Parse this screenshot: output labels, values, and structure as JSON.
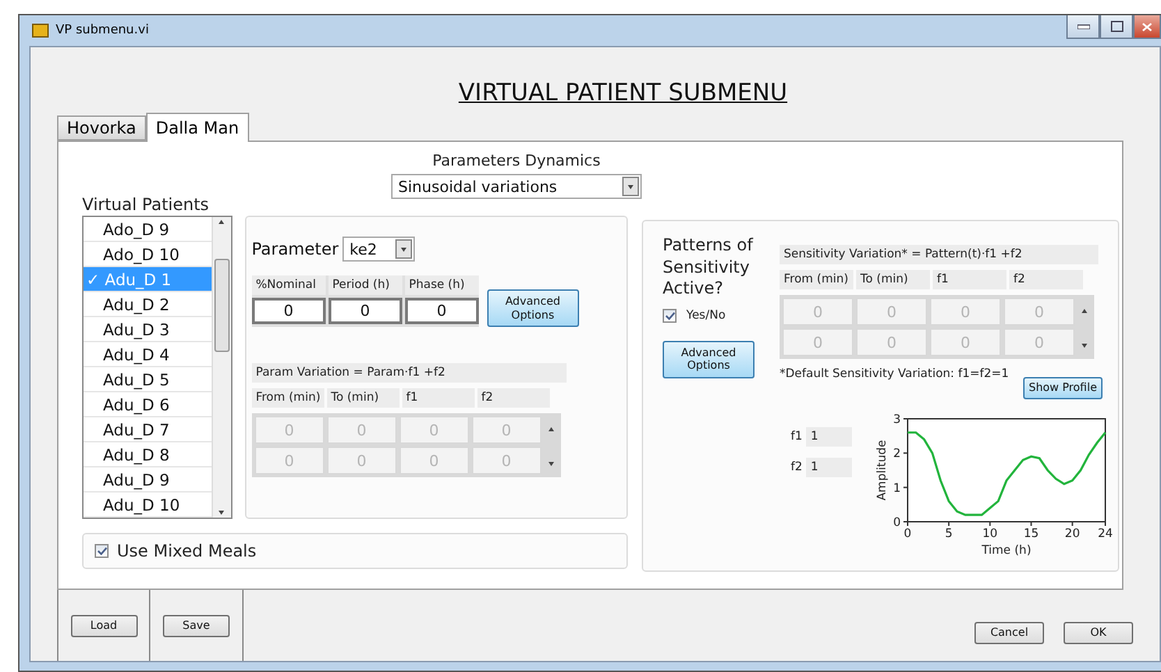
{
  "window": {
    "title": "VP submenu.vi"
  },
  "heading": "VIRTUAL PATIENT SUBMENU",
  "tabs": [
    {
      "label": "Hovorka",
      "selected": false
    },
    {
      "label": "Dalla Man",
      "selected": true
    }
  ],
  "parameters_dynamics": {
    "label": "Parameters Dynamics",
    "value": "Sinusoidal variations"
  },
  "virtual_patients": {
    "label": "Virtual Patients",
    "check_mark": "✓",
    "items": [
      {
        "label": "Ado_D 9",
        "selected": false
      },
      {
        "label": "Ado_D 10",
        "selected": false
      },
      {
        "label": "Adu_D 1",
        "selected": true
      },
      {
        "label": "Adu_D 2",
        "selected": false
      },
      {
        "label": "Adu_D 3",
        "selected": false
      },
      {
        "label": "Adu_D 4",
        "selected": false
      },
      {
        "label": "Adu_D 5",
        "selected": false
      },
      {
        "label": "Adu_D 6",
        "selected": false
      },
      {
        "label": "Adu_D 7",
        "selected": false
      },
      {
        "label": "Adu_D 8",
        "selected": false
      },
      {
        "label": "Adu_D 9",
        "selected": false
      },
      {
        "label": "Adu_D 10",
        "selected": false
      }
    ]
  },
  "parameter": {
    "label": "Parameter",
    "value": "ke2"
  },
  "sinusoid": {
    "columns": [
      "%Nominal",
      "Period (h)",
      "Phase (h)"
    ],
    "values": [
      "0",
      "0",
      "0"
    ],
    "advanced_button": "Advanced Options"
  },
  "param_variation": {
    "formula": "Param Variation = Param·f1 +f2",
    "columns": [
      "From (min)",
      "To (min)",
      "f1",
      "f2"
    ],
    "disabled": true,
    "rows": [
      [
        "0",
        "0",
        "0",
        "0"
      ],
      [
        "0",
        "0",
        "0",
        "0"
      ]
    ]
  },
  "sensitivity": {
    "label": "Patterns of Sensitivity Active?",
    "checkbox": {
      "label": "Yes/No",
      "checked": true
    },
    "advanced_button": "Advanced Options",
    "formula": "Sensitivity Variation* = Pattern(t)·f1 +f2",
    "columns": [
      "From (min)",
      "To (min)",
      "f1",
      "f2"
    ],
    "disabled": true,
    "rows": [
      [
        "0",
        "0",
        "0",
        "0"
      ],
      [
        "0",
        "0",
        "0",
        "0"
      ]
    ],
    "footnote": "*Default Sensitivity Variation: f1=f2=1",
    "show_profile_button": "Show Profile",
    "f1": {
      "label": "f1",
      "value": "1"
    },
    "f2": {
      "label": "f2",
      "value": "1"
    },
    "chart_data": {
      "type": "line",
      "xlabel": "Time (h)",
      "ylabel": "Amplitude",
      "xlim": [
        0,
        24
      ],
      "ylim": [
        0,
        3
      ],
      "xticks": [
        0,
        5,
        10,
        15,
        20,
        24
      ],
      "yticks": [
        0,
        1,
        2,
        3
      ],
      "x": [
        0,
        1,
        2,
        3,
        4,
        5,
        6,
        7,
        8,
        9,
        10,
        11,
        12,
        13,
        14,
        15,
        16,
        17,
        18,
        19,
        20,
        21,
        22,
        23,
        24
      ],
      "series": [
        {
          "color": "#22b43c",
          "values": [
            2.6,
            2.6,
            2.4,
            2.0,
            1.2,
            0.6,
            0.3,
            0.2,
            0.2,
            0.2,
            0.4,
            0.6,
            1.2,
            1.5,
            1.8,
            1.9,
            1.85,
            1.5,
            1.25,
            1.1,
            1.2,
            1.5,
            1.95,
            2.3,
            2.6
          ]
        }
      ]
    }
  },
  "mixed_meals": {
    "label": "Use Mixed Meals",
    "checked": true
  },
  "footer": {
    "left_buttons": [
      "Load",
      "Save"
    ],
    "right_buttons": [
      "Cancel",
      "OK"
    ]
  }
}
